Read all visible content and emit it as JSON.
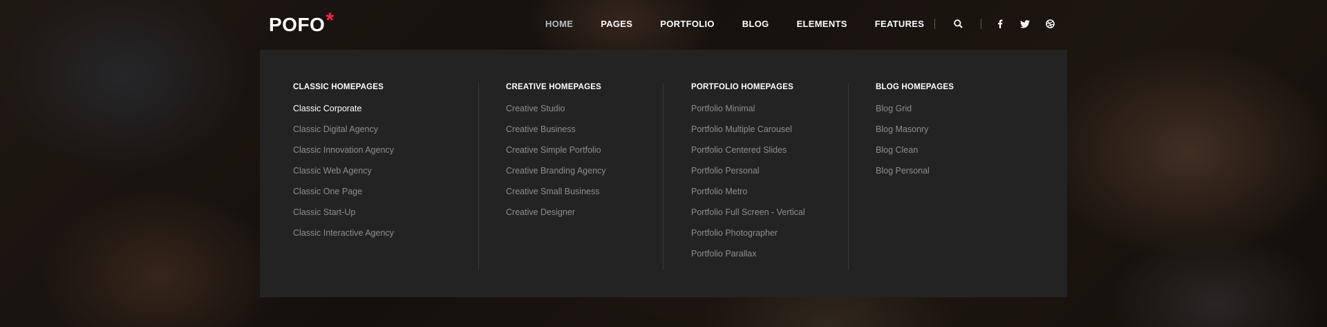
{
  "brand": {
    "name": "POFO",
    "mark": "*",
    "mark_color": "#ff214f"
  },
  "nav": {
    "items": [
      {
        "label": "HOME",
        "active": true
      },
      {
        "label": "PAGES"
      },
      {
        "label": "PORTFOLIO"
      },
      {
        "label": "BLOG"
      },
      {
        "label": "ELEMENTS"
      },
      {
        "label": "FEATURES"
      }
    ]
  },
  "tools": {
    "icons": [
      "search-icon",
      "facebook-icon",
      "twitter-icon",
      "dribbble-icon"
    ]
  },
  "mega_menu": {
    "columns": [
      {
        "title": "CLASSIC HOMEPAGES",
        "items": [
          "Classic Corporate",
          "Classic Digital Agency",
          "Classic Innovation Agency",
          "Classic Web Agency",
          "Classic One Page",
          "Classic Start-Up",
          "Classic Interactive Agency"
        ],
        "current": "Classic Corporate"
      },
      {
        "title": "CREATIVE HOMEPAGES",
        "items": [
          "Creative Studio",
          "Creative Business",
          "Creative Simple Portfolio",
          "Creative Branding Agency",
          "Creative Small Business",
          "Creative Designer"
        ]
      },
      {
        "title": "PORTFOLIO HOMEPAGES",
        "items": [
          "Portfolio Minimal",
          "Portfolio Multiple Carousel",
          "Portfolio Centered Slides",
          "Portfolio Personal",
          "Portfolio Metro",
          "Portfolio Full Screen - Vertical",
          "Portfolio Photographer",
          "Portfolio Parallax"
        ]
      },
      {
        "title": "BLOG HOMEPAGES",
        "items": [
          "Blog Grid",
          "Blog Masonry",
          "Blog Clean",
          "Blog Personal"
        ]
      }
    ]
  },
  "colors": {
    "menu_bg": "#232323",
    "accent": "#ff214f"
  }
}
